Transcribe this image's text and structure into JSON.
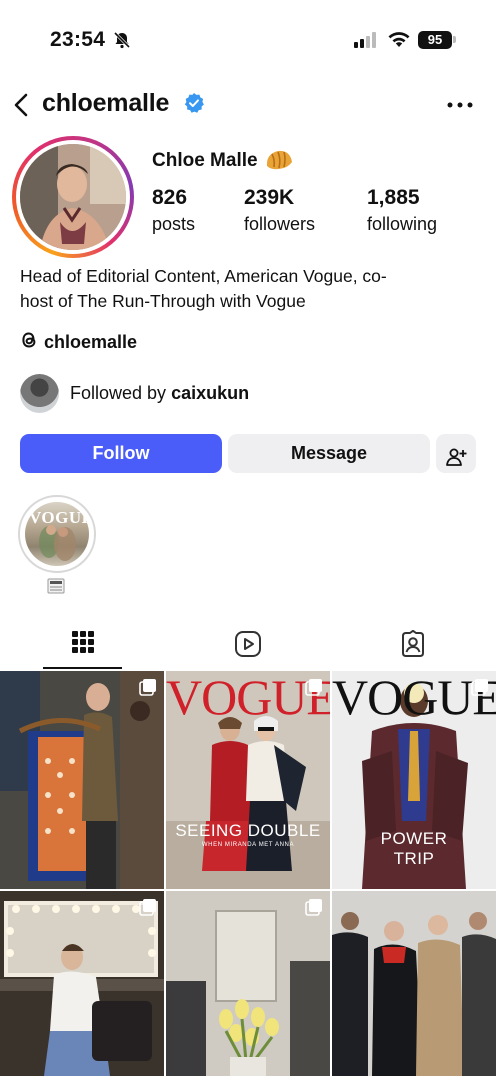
{
  "status_bar": {
    "time": "23:54",
    "battery": "95",
    "icons": [
      "bell-slash-icon",
      "signal-icon",
      "wifi-icon",
      "battery-icon"
    ]
  },
  "header": {
    "username": "chloemalle",
    "verified": true,
    "icons": [
      "back-icon",
      "verified-badge-icon",
      "more-icon"
    ]
  },
  "profile": {
    "full_name": "Chloe Malle",
    "name_emoji": "croissant-icon",
    "stats": [
      {
        "value": "826",
        "label": "posts"
      },
      {
        "value": "239K",
        "label": "followers"
      },
      {
        "value": "1,885",
        "label": "following"
      }
    ],
    "bio_line1": "Head of Editorial Content, American Vogue, co-",
    "bio_line2": "host of The Run-Through with Vogue",
    "threads_handle": "chloemalle",
    "followed_by_prefix": "Followed by ",
    "followed_by_name": "caixukun"
  },
  "actions": {
    "follow": "Follow",
    "message": "Message",
    "add_user_icon": "add-person-icon"
  },
  "highlights": [
    {
      "cover_text": "VOGUE",
      "label_icon": "newspaper-icon"
    }
  ],
  "tabs": [
    {
      "name": "grid-icon",
      "active": true
    },
    {
      "name": "reels-icon",
      "active": false
    },
    {
      "name": "tagged-icon",
      "active": false
    }
  ],
  "posts": [
    {
      "kind": "photo",
      "multi": true
    },
    {
      "kind": "cover",
      "masthead": "VOGUE",
      "headline": "SEEING DOUBLE",
      "subline": "WHEN MIRANDA MET ANNA",
      "multi": true
    },
    {
      "kind": "cover",
      "masthead": "VOGUE",
      "headline": "POWER TRIP",
      "multi": true
    },
    {
      "kind": "photo",
      "multi": true
    },
    {
      "kind": "photo",
      "multi": true
    },
    {
      "kind": "photo",
      "multi": false
    }
  ],
  "colors": {
    "follow_button": "#4a5df9",
    "secondary_button": "#efeff1",
    "verified_blue": "#3897f0",
    "vogue_red": "#d0202a"
  }
}
